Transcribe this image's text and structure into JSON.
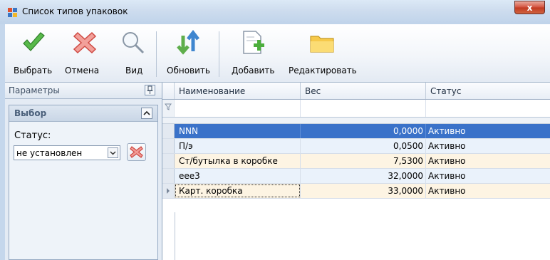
{
  "window": {
    "title": "Список типов упаковок",
    "close_label": "x"
  },
  "toolbar": {
    "buttons": [
      {
        "label": "Выбрать",
        "icon": "checkmark-icon"
      },
      {
        "label": "Отмена",
        "icon": "cancel-x-icon"
      },
      {
        "label": "Вид",
        "icon": "magnifier-icon"
      },
      {
        "label": "Обновить",
        "icon": "refresh-arrows-icon"
      },
      {
        "label": "Добавить",
        "icon": "add-document-icon"
      },
      {
        "label": "Редактировать",
        "icon": "folder-icon"
      }
    ]
  },
  "params_panel": {
    "title": "Параметры",
    "group_title": "Выбор",
    "status_label": "Статус:",
    "status_value": "не установлен"
  },
  "grid": {
    "columns": [
      "Наименование",
      "Вес",
      "Статус"
    ],
    "rows": [
      {
        "name": "NNN",
        "weight": "0,0000",
        "status": "Активно"
      },
      {
        "name": "П/э",
        "weight": "0,0500",
        "status": "Активно"
      },
      {
        "name": "Ст/бутылка в коробке",
        "weight": "7,5300",
        "status": "Активно"
      },
      {
        "name": "eee3",
        "weight": "32,0000",
        "status": "Активно"
      },
      {
        "name": "Карт. коробка",
        "weight": "33,0000",
        "status": "Активно"
      }
    ],
    "selected_row": 0,
    "current_row": 4
  },
  "colors": {
    "selection": "#3a72c9",
    "toolbar_bg": "#f3f6fa",
    "panel_bg": "#e4ebf4",
    "row_alt": "#fdf4e3",
    "close_button": "#c13a22"
  }
}
